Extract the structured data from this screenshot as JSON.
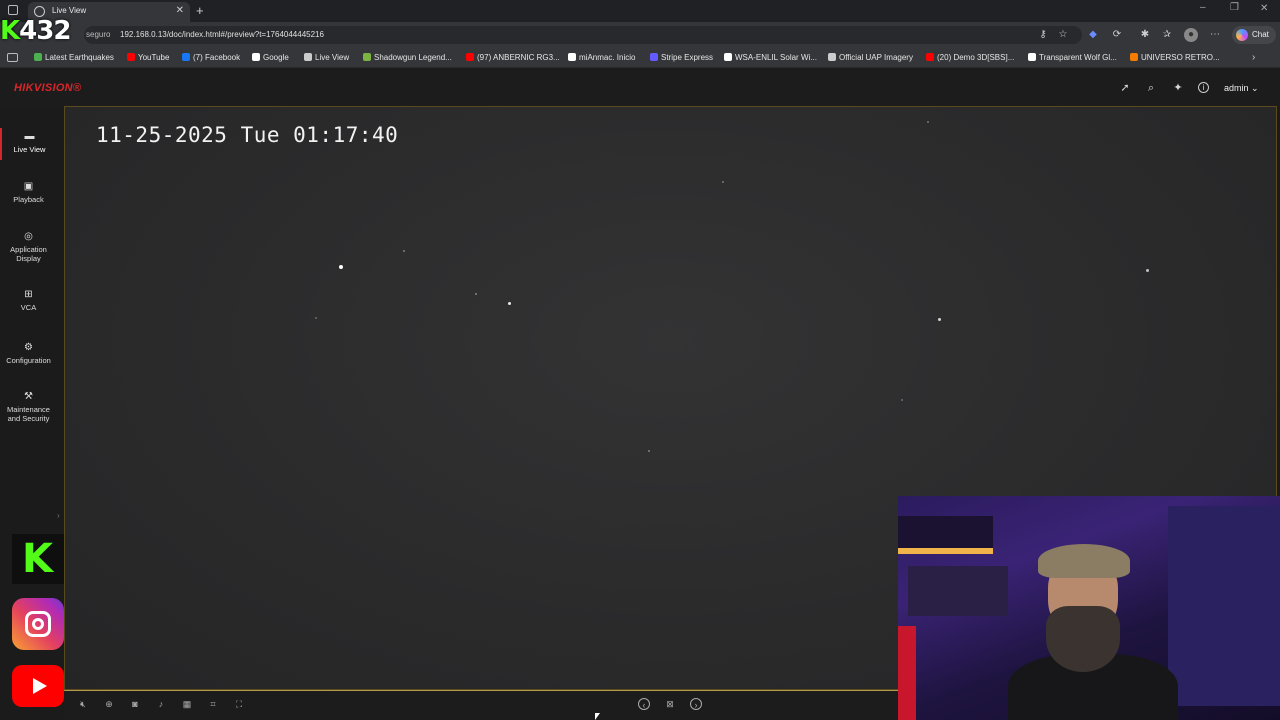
{
  "browser": {
    "tab_title": "Live View",
    "url_prefix": "seguro",
    "url": "192.168.0.13/doc/index.html#/preview?t=1764044445216",
    "chat_label": "Chat",
    "bookmarks": [
      {
        "label": "Latest Earthquakes",
        "color": "#4caf50"
      },
      {
        "label": "YouTube",
        "color": "#ff0000"
      },
      {
        "label": "(7) Facebook",
        "color": "#1877f2"
      },
      {
        "label": "Google",
        "color": "#ffffff"
      },
      {
        "label": "Live View",
        "color": "#cccccc"
      },
      {
        "label": "Shadowgun Legend...",
        "color": "#7cb342"
      },
      {
        "label": "(97) ANBERNIC RG3...",
        "color": "#ff0000"
      },
      {
        "label": "miAnmac. Inicio",
        "color": "#ffffff"
      },
      {
        "label": "Stripe Express",
        "color": "#635bff"
      },
      {
        "label": "WSA-ENLIL Solar Wi...",
        "color": "#ffffff"
      },
      {
        "label": "Official UAP Imagery",
        "color": "#cccccc"
      },
      {
        "label": "(20) Demo 3D[SBS]...",
        "color": "#ff0000"
      },
      {
        "label": "Transparent Wolf Gl...",
        "color": "#ffffff"
      },
      {
        "label": "UNIVERSO RETRO...",
        "color": "#f57c00"
      }
    ]
  },
  "overlay": {
    "channel_prefix": "K",
    "channel_number": "432"
  },
  "app": {
    "logo": "HIKVISION®",
    "user": "admin",
    "nav": [
      {
        "label": "Live View",
        "icon": "live-view-icon"
      },
      {
        "label": "Playback",
        "icon": "playback-icon"
      },
      {
        "label": "Application Display",
        "icon": "application-icon"
      },
      {
        "label": "VCA",
        "icon": "vca-icon"
      },
      {
        "label": "Configuration",
        "icon": "gear-icon"
      },
      {
        "label": "Maintenance and Security",
        "icon": "maintenance-icon"
      }
    ]
  },
  "video": {
    "osd_timestamp": "11-25-2025 Tue 01:17:40"
  },
  "colors": {
    "accent": "#d7262b",
    "video_border": "#b49a4a"
  }
}
